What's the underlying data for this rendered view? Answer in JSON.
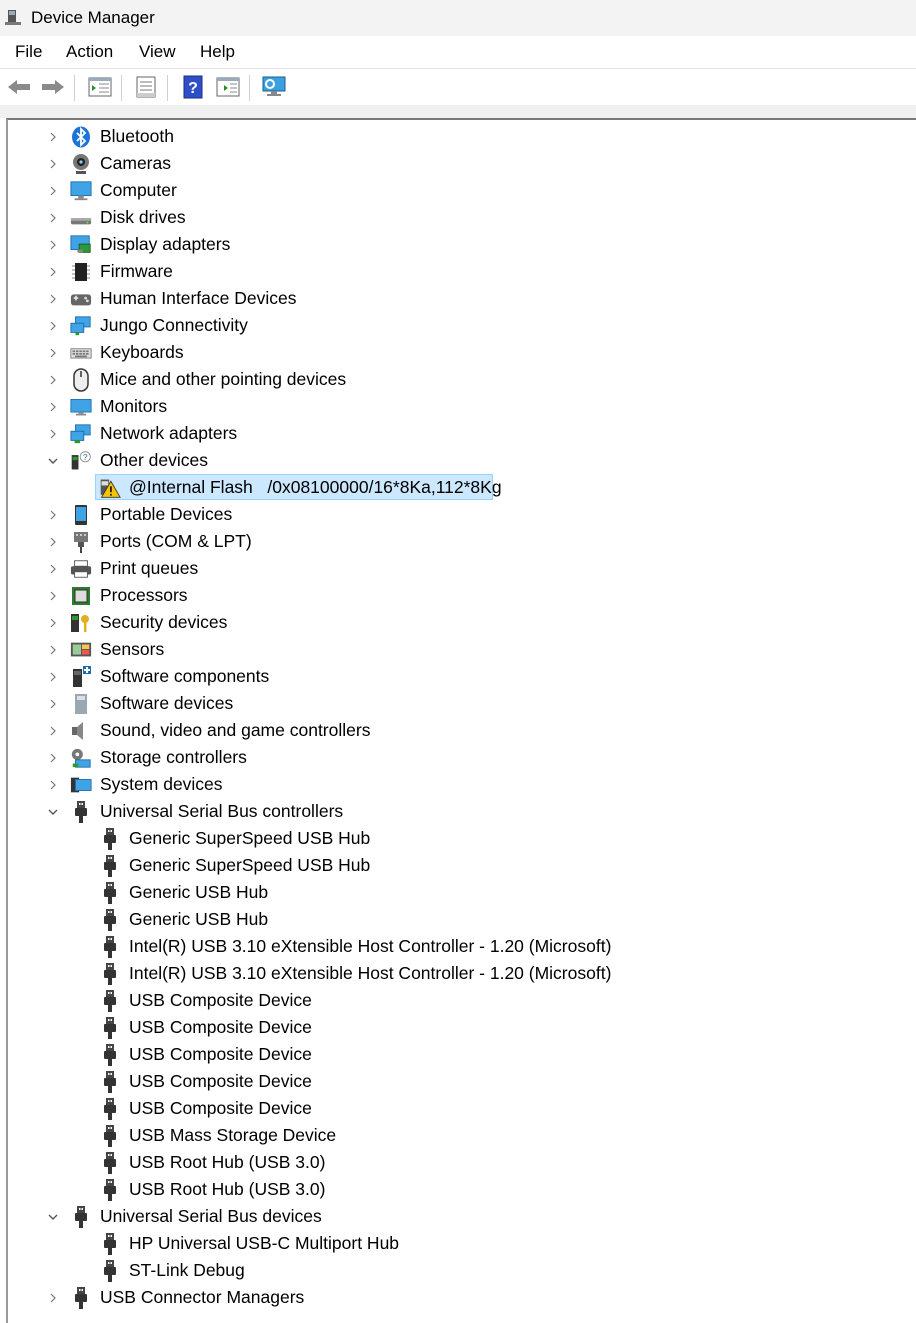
{
  "window": {
    "title": "Device Manager"
  },
  "menu": {
    "file": "File",
    "action": "Action",
    "view": "View",
    "help": "Help"
  },
  "toolbar": {
    "icons": [
      "back-arrow-icon",
      "forward-arrow-icon",
      "show-hide-tree-icon",
      "properties-icon",
      "help-icon",
      "update-driver-icon",
      "scan-hardware-icon"
    ]
  },
  "tree": {
    "categories": [
      {
        "label": "Bluetooth",
        "icon": "bluetooth-icon",
        "expanded": false
      },
      {
        "label": "Cameras",
        "icon": "camera-icon",
        "expanded": false
      },
      {
        "label": "Computer",
        "icon": "computer-icon",
        "expanded": false
      },
      {
        "label": "Disk drives",
        "icon": "disk-drive-icon",
        "expanded": false
      },
      {
        "label": "Display adapters",
        "icon": "display-adapter-icon",
        "expanded": false
      },
      {
        "label": "Firmware",
        "icon": "firmware-icon",
        "expanded": false
      },
      {
        "label": "Human Interface Devices",
        "icon": "hid-icon",
        "expanded": false
      },
      {
        "label": "Jungo Connectivity",
        "icon": "network-icon",
        "expanded": false
      },
      {
        "label": "Keyboards",
        "icon": "keyboard-icon",
        "expanded": false
      },
      {
        "label": "Mice and other pointing devices",
        "icon": "mouse-icon",
        "expanded": false
      },
      {
        "label": "Monitors",
        "icon": "monitor-icon",
        "expanded": false
      },
      {
        "label": "Network adapters",
        "icon": "network-adapter-icon",
        "expanded": false
      },
      {
        "label": "Other devices",
        "icon": "other-devices-icon",
        "expanded": true,
        "children": [
          {
            "label": "@Internal Flash   /0x08100000/16*8Ka,112*8Kg",
            "icon": "warning-device-icon",
            "selected": true
          }
        ]
      },
      {
        "label": "Portable Devices",
        "icon": "portable-device-icon",
        "expanded": false
      },
      {
        "label": "Ports (COM & LPT)",
        "icon": "port-icon",
        "expanded": false
      },
      {
        "label": "Print queues",
        "icon": "printer-icon",
        "expanded": false
      },
      {
        "label": "Processors",
        "icon": "processor-icon",
        "expanded": false
      },
      {
        "label": "Security devices",
        "icon": "security-icon",
        "expanded": false
      },
      {
        "label": "Sensors",
        "icon": "sensor-icon",
        "expanded": false
      },
      {
        "label": "Software components",
        "icon": "software-component-icon",
        "expanded": false
      },
      {
        "label": "Software devices",
        "icon": "software-device-icon",
        "expanded": false
      },
      {
        "label": "Sound, video and game controllers",
        "icon": "speaker-icon",
        "expanded": false
      },
      {
        "label": "Storage controllers",
        "icon": "storage-controller-icon",
        "expanded": false
      },
      {
        "label": "System devices",
        "icon": "system-device-icon",
        "expanded": false
      },
      {
        "label": "Universal Serial Bus controllers",
        "icon": "usb-plug-icon",
        "expanded": true,
        "children": [
          {
            "label": "Generic SuperSpeed USB Hub",
            "icon": "usb-plug-icon"
          },
          {
            "label": "Generic SuperSpeed USB Hub",
            "icon": "usb-plug-icon"
          },
          {
            "label": "Generic USB Hub",
            "icon": "usb-plug-icon"
          },
          {
            "label": "Generic USB Hub",
            "icon": "usb-plug-icon"
          },
          {
            "label": "Intel(R) USB 3.10 eXtensible Host Controller - 1.20 (Microsoft)",
            "icon": "usb-plug-icon"
          },
          {
            "label": "Intel(R) USB 3.10 eXtensible Host Controller - 1.20 (Microsoft)",
            "icon": "usb-plug-icon"
          },
          {
            "label": "USB Composite Device",
            "icon": "usb-plug-icon"
          },
          {
            "label": "USB Composite Device",
            "icon": "usb-plug-icon"
          },
          {
            "label": "USB Composite Device",
            "icon": "usb-plug-icon"
          },
          {
            "label": "USB Composite Device",
            "icon": "usb-plug-icon"
          },
          {
            "label": "USB Composite Device",
            "icon": "usb-plug-icon"
          },
          {
            "label": "USB Mass Storage Device",
            "icon": "usb-plug-icon"
          },
          {
            "label": "USB Root Hub (USB 3.0)",
            "icon": "usb-plug-icon"
          },
          {
            "label": "USB Root Hub (USB 3.0)",
            "icon": "usb-plug-icon"
          }
        ]
      },
      {
        "label": "Universal Serial Bus devices",
        "icon": "usb-plug-icon",
        "expanded": true,
        "children": [
          {
            "label": "HP Universal USB-C Multiport Hub",
            "icon": "usb-plug-icon"
          },
          {
            "label": "ST-Link Debug",
            "icon": "usb-plug-icon"
          }
        ]
      },
      {
        "label": "USB Connector Managers",
        "icon": "usb-plug-icon",
        "expanded": false
      }
    ]
  }
}
